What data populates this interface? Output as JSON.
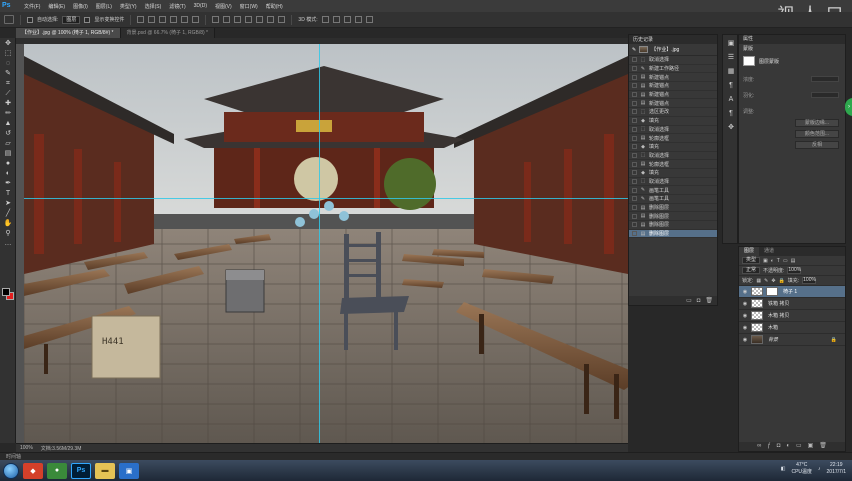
{
  "app": {
    "logo": "Ps",
    "watermark": "视 人 口"
  },
  "menu": [
    "文件(F)",
    "编辑(E)",
    "图像(I)",
    "图层(L)",
    "类型(Y)",
    "选择(S)",
    "滤镜(T)",
    "3D(D)",
    "视图(V)",
    "窗口(W)",
    "帮助(H)"
  ],
  "options": {
    "auto_select_label": "自动选择:",
    "auto_select_value": "图层",
    "show_transform_label": "显示变换控件",
    "mode_3d_label": "3D 模式:"
  },
  "tabs": [
    {
      "label": "【作业】.jpg @ 100% (椅子 1, RGB/8#) *",
      "active": true
    },
    {
      "label": "背景.psd @ 66.7% (椅子 1, RGB/8) *",
      "active": false
    }
  ],
  "status": {
    "zoom": "100%",
    "doc_size": "文档:3.56M/29.3M"
  },
  "timeline_label": "时间轴",
  "history": {
    "title": "历史记录",
    "snapshot": "【作业】.jpg",
    "items": [
      {
        "icon": "dotted-rect",
        "label": "取消选择"
      },
      {
        "icon": "brush",
        "label": "新建工作路径"
      },
      {
        "icon": "doc",
        "label": "新建锚点"
      },
      {
        "icon": "doc",
        "label": "新建锚点"
      },
      {
        "icon": "doc",
        "label": "新建锚点"
      },
      {
        "icon": "doc",
        "label": "新建锚点"
      },
      {
        "icon": "dotted-rect",
        "label": "选区更改"
      },
      {
        "icon": "bucket",
        "label": "填充"
      },
      {
        "icon": "dotted-rect",
        "label": "取消选择"
      },
      {
        "icon": "doc",
        "label": "轮廓选框"
      },
      {
        "icon": "bucket",
        "label": "填充"
      },
      {
        "icon": "dotted-rect",
        "label": "取消选择"
      },
      {
        "icon": "doc",
        "label": "轮廓选框"
      },
      {
        "icon": "bucket",
        "label": "填充"
      },
      {
        "icon": "dotted-rect",
        "label": "取消选择"
      },
      {
        "icon": "brush",
        "label": "画笔工具"
      },
      {
        "icon": "brush",
        "label": "画笔工具"
      },
      {
        "icon": "doc",
        "label": "删除图层"
      },
      {
        "icon": "doc",
        "label": "删除图层"
      },
      {
        "icon": "doc",
        "label": "删除图层"
      },
      {
        "icon": "doc",
        "label": "删除图层"
      }
    ]
  },
  "properties": {
    "title": "属性",
    "subtitle": "蒙版",
    "mask_label": "图层蒙版",
    "density_label": "浓度:",
    "feather_label": "羽化:",
    "refine_label": "调整:",
    "buttons": [
      "蒙版边缘...",
      "颜色范围...",
      "反相"
    ]
  },
  "layers": {
    "tabs": [
      "图层",
      "通道"
    ],
    "kind_label": "类型",
    "blend_mode": "正常",
    "opacity_label": "不透明度:",
    "opacity": "100%",
    "lock_label": "锁定:",
    "fill_label": "填充:",
    "fill": "100%",
    "items": [
      {
        "name": "椅子 1",
        "has_mask": true,
        "active": true,
        "italic": false,
        "bg": false
      },
      {
        "name": "铁箱 拷贝",
        "has_mask": false,
        "active": false,
        "italic": false,
        "bg": false
      },
      {
        "name": "木箱 拷贝",
        "has_mask": false,
        "active": false,
        "italic": false,
        "bg": false
      },
      {
        "name": "木箱",
        "has_mask": false,
        "active": false,
        "italic": false,
        "bg": false
      },
      {
        "name": "背景",
        "has_mask": false,
        "active": false,
        "italic": true,
        "bg": true
      }
    ]
  },
  "scene": {
    "crate_stamp": "H441"
  },
  "taskbar": {
    "temp": "47°C",
    "cpu_label": "CPU温度",
    "time": "22:19",
    "date": "2017/7/1"
  },
  "colors": {
    "accent": "#31a8ff",
    "selection": "#56708a",
    "guide": "#30c8e8",
    "bg_swatch": "#e31e1e"
  }
}
